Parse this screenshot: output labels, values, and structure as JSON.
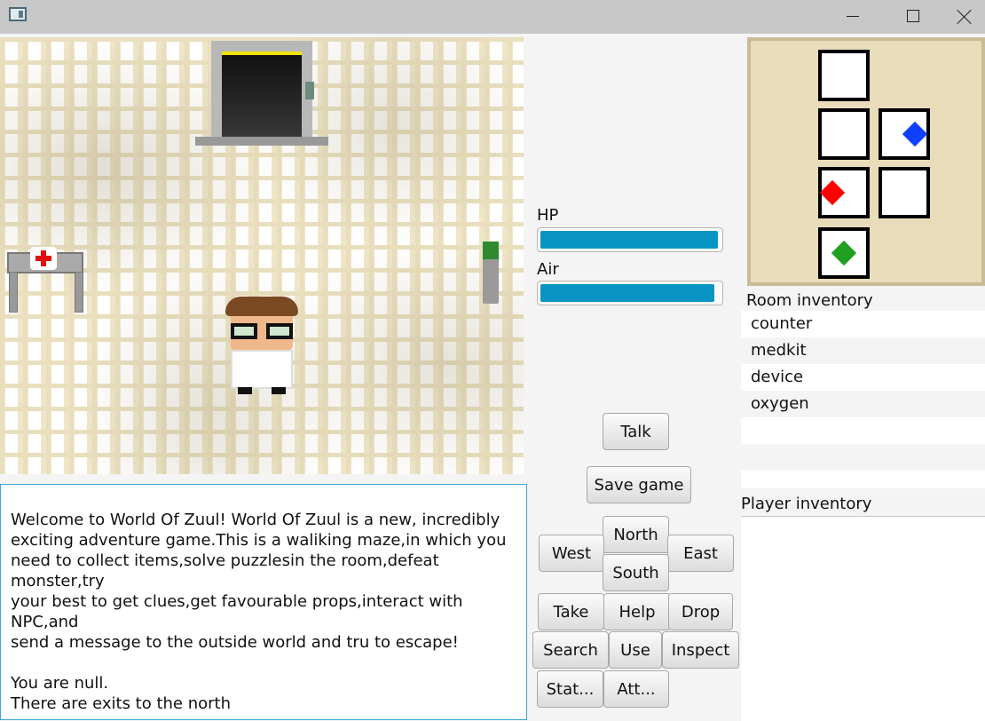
{
  "window": {
    "title": ""
  },
  "stats": {
    "hp_label": "HP",
    "hp_fraction": 0.99,
    "air_label": "Air",
    "air_fraction": 0.97
  },
  "minimap": {
    "marker_colors": {
      "blue": "#1040ff",
      "red": "#ff0000",
      "green": "#20a020"
    }
  },
  "room_inventory": {
    "label": "Room inventory",
    "items": [
      "counter",
      "medkit",
      "device",
      "oxygen",
      "",
      "",
      ""
    ]
  },
  "player_inventory": {
    "label": "Player inventory",
    "items": []
  },
  "message": {
    "text": "Welcome to World Of Zuul! World Of Zuul is a new, incredibly\nexciting adventure game.This is a waliking maze,in which you\nneed to collect items,solve puzzlesin the room,defeat monster,try\nyour best to get clues,get favourable props,interact with NPC,and\nsend a message to the outside world and tru to escape!\n\nYou are null.\nThere are exits to the north"
  },
  "buttons": {
    "talk": "Talk",
    "save": "Save game",
    "north": "North",
    "west": "West",
    "east": "East",
    "south": "South",
    "take": "Take",
    "help": "Help",
    "drop": "Drop",
    "search": "Search",
    "use": "Use",
    "inspect": "Inspect",
    "stat": "Stat...",
    "att": "Att..."
  }
}
